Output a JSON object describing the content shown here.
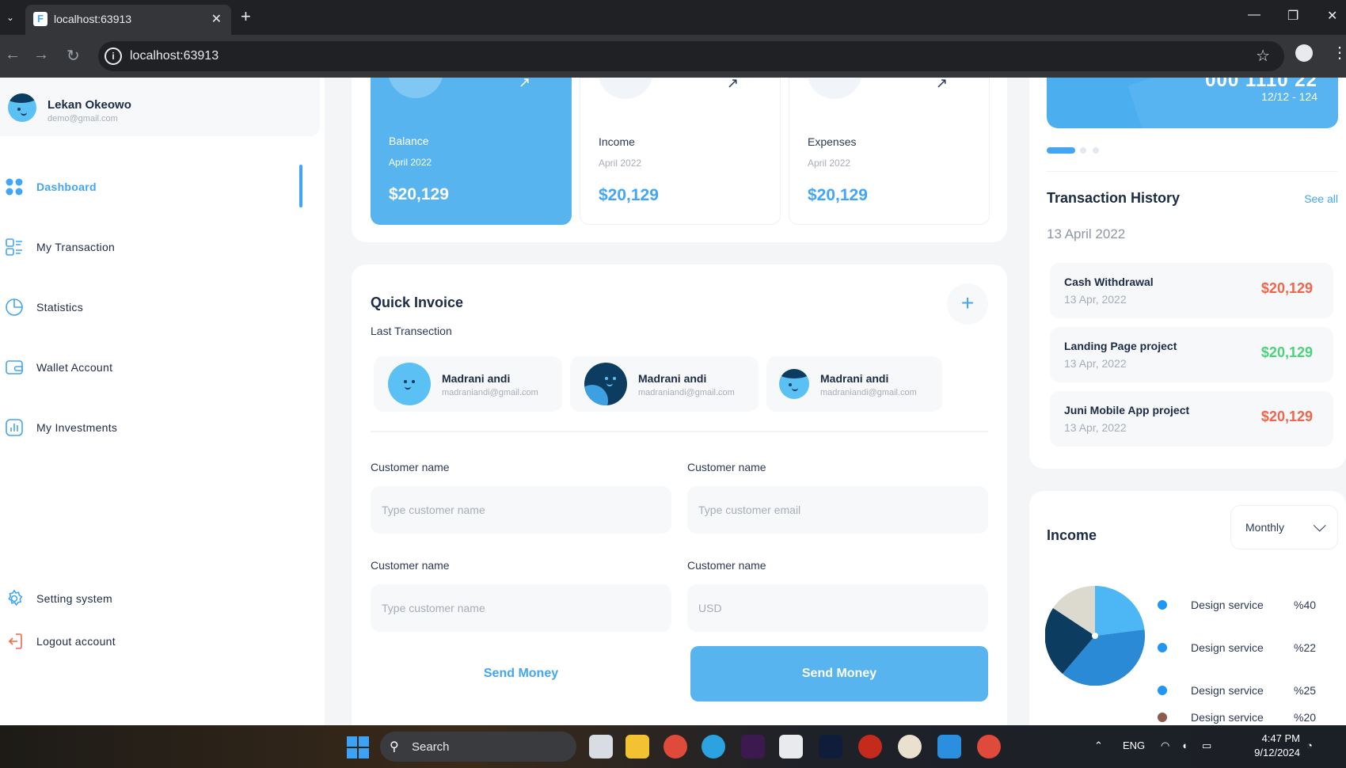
{
  "browser": {
    "tab_title": "localhost:63913",
    "url": "localhost:63913",
    "favicon_letter": "F"
  },
  "sidebar": {
    "user": {
      "name": "Lekan Okeowo",
      "email": "demo@gmail.com"
    },
    "items": [
      {
        "label": "Dashboard",
        "icon": "grid-icon",
        "active": true
      },
      {
        "label": "My Transaction",
        "icon": "transaction-icon"
      },
      {
        "label": "Statistics",
        "icon": "pie-chart-icon"
      },
      {
        "label": "Wallet Account",
        "icon": "wallet-icon"
      },
      {
        "label": "My Investments",
        "icon": "investment-icon"
      }
    ],
    "bottom_items": [
      {
        "label": "Setting system",
        "icon": "gear-icon"
      },
      {
        "label": "Logout account",
        "icon": "logout-icon"
      }
    ]
  },
  "stats": [
    {
      "title": "Balance",
      "date": "April 2022",
      "value": "$20,129"
    },
    {
      "title": "Income",
      "date": "April 2022",
      "value": "$20,129"
    },
    {
      "title": "Expenses",
      "date": "April 2022",
      "value": "$20,129"
    }
  ],
  "invoice": {
    "title": "Quick Invoice",
    "subtitle": "Last Transection",
    "contacts": [
      {
        "name": "Madrani andi",
        "email": "madraniandi@gmail.com"
      },
      {
        "name": "Madrani andi",
        "email": "madraniandi@gmail.com"
      },
      {
        "name": "Madrani andi",
        "email": "madraniandi@gmail.com"
      }
    ],
    "fields": [
      {
        "label": "Customer name",
        "placeholder": "Type customer name"
      },
      {
        "label": "Customer name",
        "placeholder": "Type customer email"
      },
      {
        "label": "Customer name",
        "placeholder": "Type customer name"
      },
      {
        "label": "Customer name",
        "placeholder": "USD"
      }
    ],
    "btn_secondary": "Send Money",
    "btn_primary": "Send Money"
  },
  "card": {
    "number_partial": "000 1110 22",
    "expiry": "12/12 - 124"
  },
  "transactions": {
    "title": "Transaction History",
    "see_all": "See all",
    "date": "13 April 2022",
    "items": [
      {
        "name": "Cash Withdrawal",
        "date": "13 Apr, 2022",
        "amount": "$20,129",
        "color": "#f0654b"
      },
      {
        "name": "Landing Page project",
        "date": "13 Apr, 2022",
        "amount": "$20,129",
        "color": "#4cd27a"
      },
      {
        "name": "Juni Mobile App project",
        "date": "13 Apr, 2022",
        "amount": "$20,129",
        "color": "#f0654b"
      }
    ]
  },
  "income": {
    "title": "Income",
    "period": "Monthly",
    "legend": [
      {
        "label": "Design service",
        "pct": "%40",
        "color": "#2196f3"
      },
      {
        "label": "Design service",
        "pct": "%22",
        "color": "#2196f3"
      },
      {
        "label": "Design service",
        "pct": "%25",
        "color": "#2196f3"
      },
      {
        "label": "Design service",
        "pct": "%20",
        "color": "#8d5b4c"
      }
    ]
  },
  "taskbar": {
    "search": "Search",
    "lang": "ENG",
    "time": "4:47 PM",
    "date": "9/12/2024"
  },
  "colors": {
    "accent": "#42a5f5",
    "accent_fill": "#57b4ef",
    "negative": "#f0654b",
    "positive": "#4cd27a"
  }
}
